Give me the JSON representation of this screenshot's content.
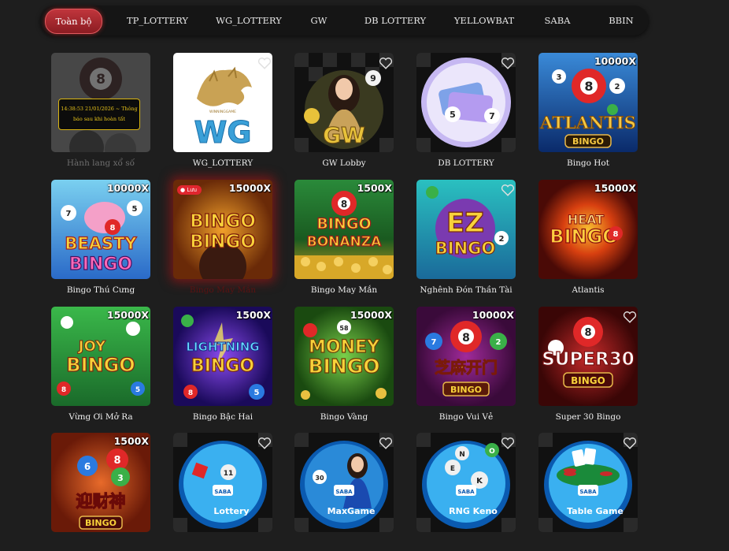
{
  "tabs": [
    {
      "label": "Toàn bộ",
      "active": true
    },
    {
      "label": "TP_LOTTERY"
    },
    {
      "label": "WG_LOTTERY"
    },
    {
      "label": "GW"
    },
    {
      "label": "DB LOTTERY"
    },
    {
      "label": "YELLOWBAT"
    },
    {
      "label": "SABA"
    },
    {
      "label": "BBIN"
    }
  ],
  "games": [
    {
      "caption": "Hành lang xổ số",
      "overlay": "14:38:53 21/01/2026 ~ Thông báo sau khi hoàn tất"
    },
    {
      "caption": "WG_LOTTERY",
      "logo": "WG",
      "logo_sub": "WINNINGGAME"
    },
    {
      "caption": "GW Lobby",
      "logo": "GW"
    },
    {
      "caption": "DB LOTTERY"
    },
    {
      "caption": "Bingo Hot",
      "multiplier": "10000X",
      "logo": "ATLANTIS",
      "logo_sub": "BINGO"
    },
    {
      "caption": "Bingo Thú Cưng",
      "multiplier": "10000X",
      "logo": "BEASTY",
      "logo_sub": "BINGO"
    },
    {
      "caption": "Bingo May Mắn",
      "multiplier": "15000X",
      "logo": "BINGO",
      "logo_sub": "BINGO",
      "badge": "Lưu"
    },
    {
      "caption": "Bingo May Mắn",
      "multiplier": "1500X",
      "logo": "BINGO",
      "logo_sub": "BONANZA"
    },
    {
      "caption": "Nghênh Đón Thần Tài",
      "logo": "EZ",
      "logo_sub": "BINGO"
    },
    {
      "caption": "Atlantis",
      "multiplier": "15000X",
      "logo": "HEAT",
      "logo_sub": "BINGO"
    },
    {
      "caption": "Vừng Ơi Mở Ra",
      "multiplier": "15000X",
      "logo": "JOY",
      "logo_sub": "BINGO"
    },
    {
      "caption": "Bingo Bậc Hai",
      "multiplier": "1500X",
      "logo": "LIGHTNING",
      "logo_sub": "BINGO"
    },
    {
      "caption": "Bingo Vàng",
      "multiplier": "15000X",
      "logo": "MONEY",
      "logo_sub": "BINGO"
    },
    {
      "caption": "Bingo Vui Vẻ",
      "multiplier": "10000X",
      "logo": "芝麻开门",
      "logo_sub": "BINGO"
    },
    {
      "caption": "Super 30 Bingo",
      "logo": "SUPER30",
      "logo_sub": "BINGO"
    },
    {
      "caption": "",
      "multiplier": "1500X",
      "logo": "迎财神",
      "logo_sub": "BINGO"
    },
    {
      "caption": "",
      "logo": "Lottery",
      "logo_sub": "SABA"
    },
    {
      "caption": "",
      "logo": "MaxGame",
      "logo_sub": "SABA"
    },
    {
      "caption": "",
      "logo": "RNG Keno",
      "logo_sub": "SABA"
    },
    {
      "caption": "",
      "logo": "Table Game",
      "logo_sub": "SABA"
    }
  ]
}
